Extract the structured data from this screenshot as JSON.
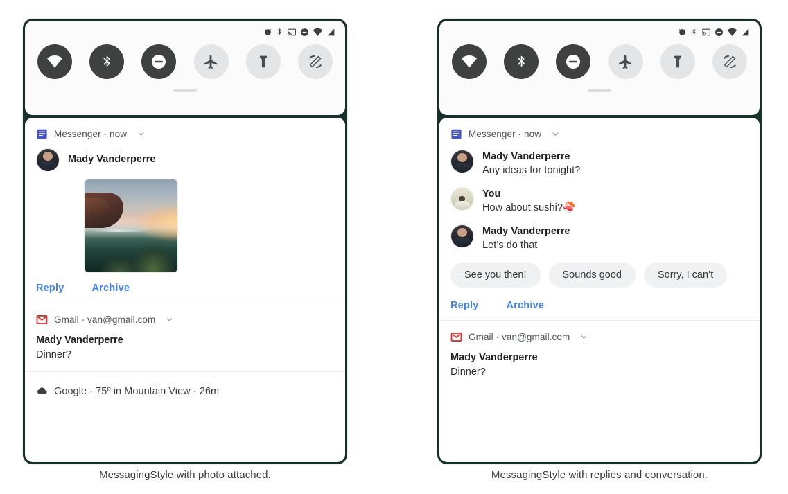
{
  "colors": {
    "frame": "#16302c",
    "tile_on": "#3f4040",
    "tile_off": "#e4e5e6",
    "link_blue": "#4083f2",
    "messenger_blue": "#4354cf",
    "gmail_red": "#d93025",
    "chip_bg": "#f0f1f2"
  },
  "statusbar": {
    "icons": [
      "alarm-icon",
      "bluetooth-icon",
      "cast-icon",
      "do-not-disturb-icon",
      "wifi-icon",
      "signal-icon"
    ]
  },
  "quick_settings": {
    "tiles": [
      {
        "name": "wifi-tile",
        "icon": "wifi-icon",
        "state": "on"
      },
      {
        "name": "bluetooth-tile",
        "icon": "bluetooth-icon",
        "state": "on"
      },
      {
        "name": "dnd-tile",
        "icon": "do-not-disturb-icon",
        "state": "on"
      },
      {
        "name": "airplane-tile",
        "icon": "airplane-icon",
        "state": "off"
      },
      {
        "name": "flashlight-tile",
        "icon": "flashlight-icon",
        "state": "off"
      },
      {
        "name": "auto-rotate-tile",
        "icon": "auto-rotate-icon",
        "state": "off"
      }
    ]
  },
  "left_phone": {
    "messenger": {
      "app_label": "Messenger · now",
      "app_icon": "messenger-icon",
      "sender": "Mady Vanderperre",
      "photo_alt": "sunset-landscape-photo",
      "actions": [
        "Reply",
        "Archive"
      ]
    },
    "gmail": {
      "app_label": "Gmail · van@gmail.com",
      "app_icon": "gmail-icon",
      "title": "Mady Vanderperre",
      "subtitle": "Dinner?"
    },
    "google": {
      "app_icon": "cloud-icon",
      "text": "Google · 75º in Mountain View · 26m"
    }
  },
  "right_phone": {
    "messenger": {
      "app_label": "Messenger · now",
      "app_icon": "messenger-icon",
      "messages": [
        {
          "sender": "Mady Vanderperre",
          "text": "Any ideas for tonight?",
          "avatar": "dark"
        },
        {
          "sender": "You",
          "text": "How about sushi?🍣",
          "avatar": "light"
        },
        {
          "sender": "Mady Vanderperre",
          "text": "Let’s do that",
          "avatar": "dark"
        }
      ],
      "chips": [
        "See you then!",
        "Sounds good",
        "Sorry, I can’t"
      ],
      "actions": [
        "Reply",
        "Archive"
      ]
    },
    "gmail": {
      "app_label": "Gmail · van@gmail.com",
      "app_icon": "gmail-icon",
      "title": "Mady Vanderperre",
      "subtitle": "Dinner?"
    }
  },
  "captions": {
    "left": "MessagingStyle with photo attached.",
    "right": "MessagingStyle with replies and conversation."
  }
}
